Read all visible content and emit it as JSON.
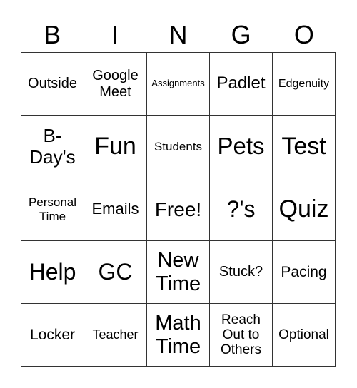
{
  "header": {
    "letters": [
      "B",
      "I",
      "N",
      "G",
      "O"
    ]
  },
  "card": {
    "rows": [
      [
        "Outside",
        "Google Meet",
        "Assignments",
        "Padlet",
        "Edgenuity"
      ],
      [
        "B-Day's",
        "Fun",
        "Students",
        "Pets",
        "Test"
      ],
      [
        "Personal Time",
        "Emails",
        "Free!",
        "?'s",
        "Quiz"
      ],
      [
        "Help",
        "GC",
        "New Time",
        "Stuck?",
        "Pacing"
      ],
      [
        "Locker",
        "Teacher",
        "Math Time",
        "Reach Out to Others",
        "Optional"
      ]
    ]
  }
}
